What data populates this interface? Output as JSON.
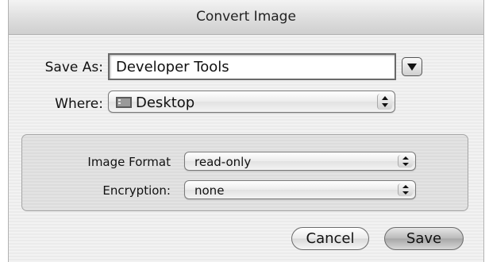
{
  "dialog": {
    "title": "Convert Image"
  },
  "save_as": {
    "label": "Save As:",
    "value": "Developer Tools",
    "disclosure_icon": "triangle-down-icon"
  },
  "where": {
    "label": "Where:",
    "value": "Desktop",
    "folder_icon": "desktop-folder-icon"
  },
  "options": {
    "image_format": {
      "label": "Image Format",
      "value": "read-only"
    },
    "encryption": {
      "label": "Encryption:",
      "value": "none"
    }
  },
  "buttons": {
    "cancel": "Cancel",
    "save": "Save"
  }
}
